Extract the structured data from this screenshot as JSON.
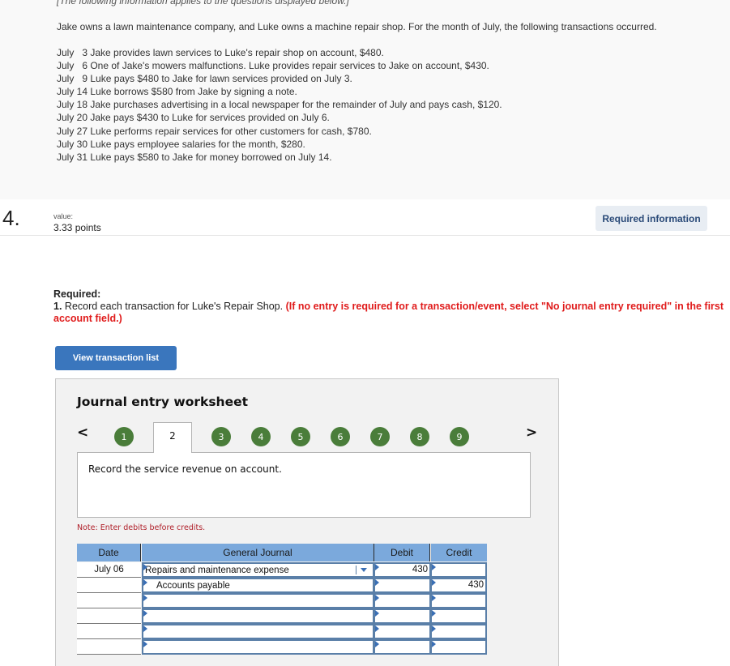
{
  "info": {
    "intro": "[The following information applies to the questions displayed below.]",
    "lead": "Jake owns a lawn maintenance company, and Luke owns a machine repair shop. For the month of July, the following transactions occurred.",
    "transactions": [
      "July   3 Jake provides lawn services to Luke's repair shop on account, $480.",
      "July   6 One of Jake's mowers malfunctions. Luke provides repair services to Jake on account, $430.",
      "July   9 Luke pays $480 to Jake for lawn services provided on July 3.",
      "July 14 Luke borrows $580 from Jake by signing a note.",
      "July 18 Jake purchases advertising in a local newspaper for the remainder of July and pays cash, $120.",
      "July 20 Jake pays $430 to Luke for services provided on July 6.",
      "July 27 Luke performs repair services for other customers for cash, $780.",
      "July 30 Luke pays employee salaries for the month, $280.",
      "July 31 Luke pays $580 to Jake for money borrowed on July 14."
    ]
  },
  "question": {
    "number": "4.",
    "value_label": "value:",
    "points": "3.33 points",
    "required_info_button": "Required information"
  },
  "required": {
    "title": "Required:",
    "item_number": "1.",
    "item_text": " Record each transaction for Luke's Repair Shop. ",
    "item_note": "(If no entry is required for a transaction/event, select \"No journal entry required\" in the first account field.)"
  },
  "view_transaction_list_button": "View transaction list",
  "worksheet": {
    "title": "Journal entry worksheet",
    "prev_label": "<",
    "next_label": ">",
    "steps": [
      "1",
      "2",
      "3",
      "4",
      "5",
      "6",
      "7",
      "8",
      "9"
    ],
    "active_step": "2",
    "description": "Record the service revenue on account.",
    "note": "Note: Enter debits before credits.",
    "columns": {
      "date": "Date",
      "general_journal": "General Journal",
      "debit": "Debit",
      "credit": "Credit"
    },
    "rows": [
      {
        "date": "July 06",
        "account": "Repairs and maintenance expense",
        "debit": "430",
        "credit": ""
      },
      {
        "date": "",
        "account": "Accounts payable",
        "debit": "",
        "credit": "430"
      },
      {
        "date": "",
        "account": "",
        "debit": "",
        "credit": ""
      },
      {
        "date": "",
        "account": "",
        "debit": "",
        "credit": ""
      },
      {
        "date": "",
        "account": "",
        "debit": "",
        "credit": ""
      },
      {
        "date": "",
        "account": "",
        "debit": "",
        "credit": ""
      }
    ]
  },
  "colors": {
    "step_complete": "#4a7d3a",
    "primary_button": "#3a76bd",
    "grid_header": "#7ba9dc",
    "instruction_red": "#e01b1b"
  }
}
